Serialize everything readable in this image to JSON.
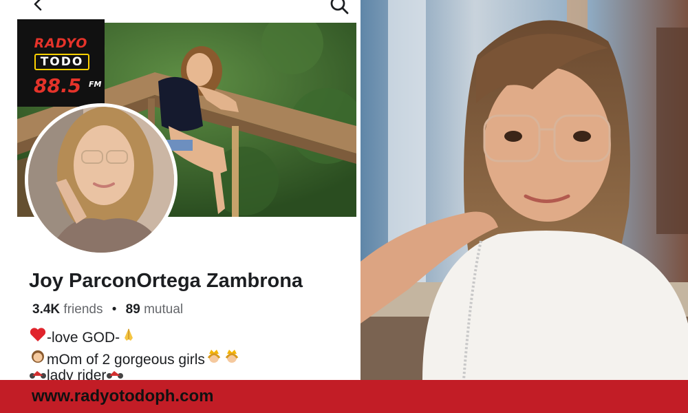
{
  "logo": {
    "line1": "RADYO",
    "line2": "TODO",
    "frequency": "88.5",
    "band": "FM"
  },
  "profile": {
    "name": "Joy ParconOrtega Zambrona",
    "friends_count": "3.4K",
    "friends_label": "friends",
    "separator": "•",
    "mutual_count": "89",
    "mutual_label": "mutual",
    "bio": [
      {
        "icon": "red-heart-icon",
        "text": "-love GOD-",
        "trail_icon": "praying-hands-icon"
      },
      {
        "icon": "girl-icon",
        "text": "mOm of 2 gorgeous girls",
        "trail_icon": "princess-icon"
      },
      {
        "icon": "motorcycle-icon",
        "text": "lady rider",
        "trail_icon": "motorcycle-icon"
      }
    ]
  },
  "banner": {
    "url": "www.radyotodoph.com"
  },
  "colors": {
    "banner": "#c21d26",
    "logo_red": "#e5332a",
    "logo_yellow": "#ffd200"
  }
}
